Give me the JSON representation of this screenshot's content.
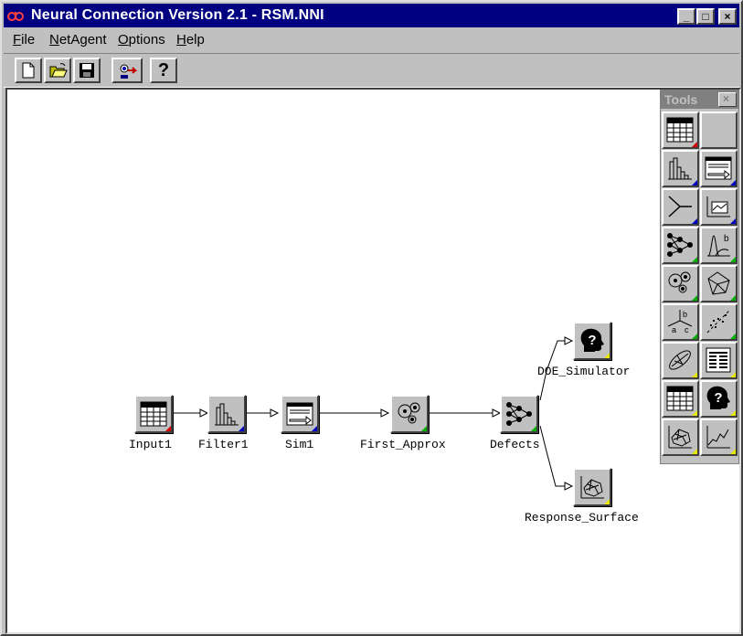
{
  "window": {
    "title": "Neural Connection Version 2.1 - RSM.NNI",
    "controls": {
      "minimize": "_",
      "maximize": "□",
      "close": "×"
    }
  },
  "menubar": {
    "items": [
      {
        "label": "File",
        "accel": "F",
        "rest": "ile"
      },
      {
        "label": "NetAgent",
        "accel": "N",
        "rest": "etAgent"
      },
      {
        "label": "Options",
        "accel": "O",
        "rest": "ptions"
      },
      {
        "label": "Help",
        "accel": "H",
        "rest": "elp"
      }
    ]
  },
  "toolbar": {
    "buttons": [
      "new-icon",
      "open-icon",
      "save-icon",
      "netagent-icon",
      "help-icon"
    ],
    "help_label": "?"
  },
  "diagram": {
    "nodes": [
      {
        "label": "Input1",
        "icon": "data-table-icon",
        "corner": "#d40000"
      },
      {
        "label": "Filter1",
        "icon": "histogram-icon",
        "corner": "#0000c0"
      },
      {
        "label": "Sim1",
        "icon": "simulator-icon",
        "corner": "#0000c0"
      },
      {
        "label": "First_Approx",
        "icon": "rbf-icon",
        "corner": "#00b000"
      },
      {
        "label": "Defects",
        "icon": "mlp-icon",
        "corner": "#00b000"
      },
      {
        "label": "DOE_Simulator",
        "icon": "head-question-icon",
        "corner": "#e8e800"
      },
      {
        "label": "Response_Surface",
        "icon": "response-surface-icon",
        "corner": "#e8e800"
      }
    ]
  },
  "palette": {
    "title": "Tools",
    "close": "×",
    "tools": [
      {
        "icon": "data-table-icon",
        "corner": "#d40000"
      },
      {
        "icon": "blank-tool-icon",
        "corner": ""
      },
      {
        "icon": "histogram-icon",
        "corner": "#0000c0"
      },
      {
        "icon": "simulator-icon",
        "corner": "#0000c0"
      },
      {
        "icon": "merge-icon",
        "corner": "#0000c0"
      },
      {
        "icon": "plot-icon",
        "corner": "#0000c0"
      },
      {
        "icon": "mlp-icon",
        "corner": "#00b000"
      },
      {
        "icon": "bayes-icon",
        "corner": "#00b000"
      },
      {
        "icon": "rbf-icon",
        "corner": "#00b000"
      },
      {
        "icon": "kohonen-icon",
        "corner": "#00b000"
      },
      {
        "icon": "tree-abc-icon",
        "corner": "#00b000"
      },
      {
        "icon": "scatter-icon",
        "corner": "#00b000"
      },
      {
        "icon": "ellipse-icon",
        "corner": "#e8e800"
      },
      {
        "icon": "text-report-icon",
        "corner": "#e8e800"
      },
      {
        "icon": "table-output-icon",
        "corner": "#e8e800"
      },
      {
        "icon": "head-question-icon",
        "corner": "#e8e800"
      },
      {
        "icon": "response-surface-icon",
        "corner": "#e8e800"
      },
      {
        "icon": "line-graph-icon",
        "corner": "#e8e800"
      }
    ],
    "tree_labels": {
      "a": "a",
      "b": "b",
      "c": "c"
    }
  }
}
